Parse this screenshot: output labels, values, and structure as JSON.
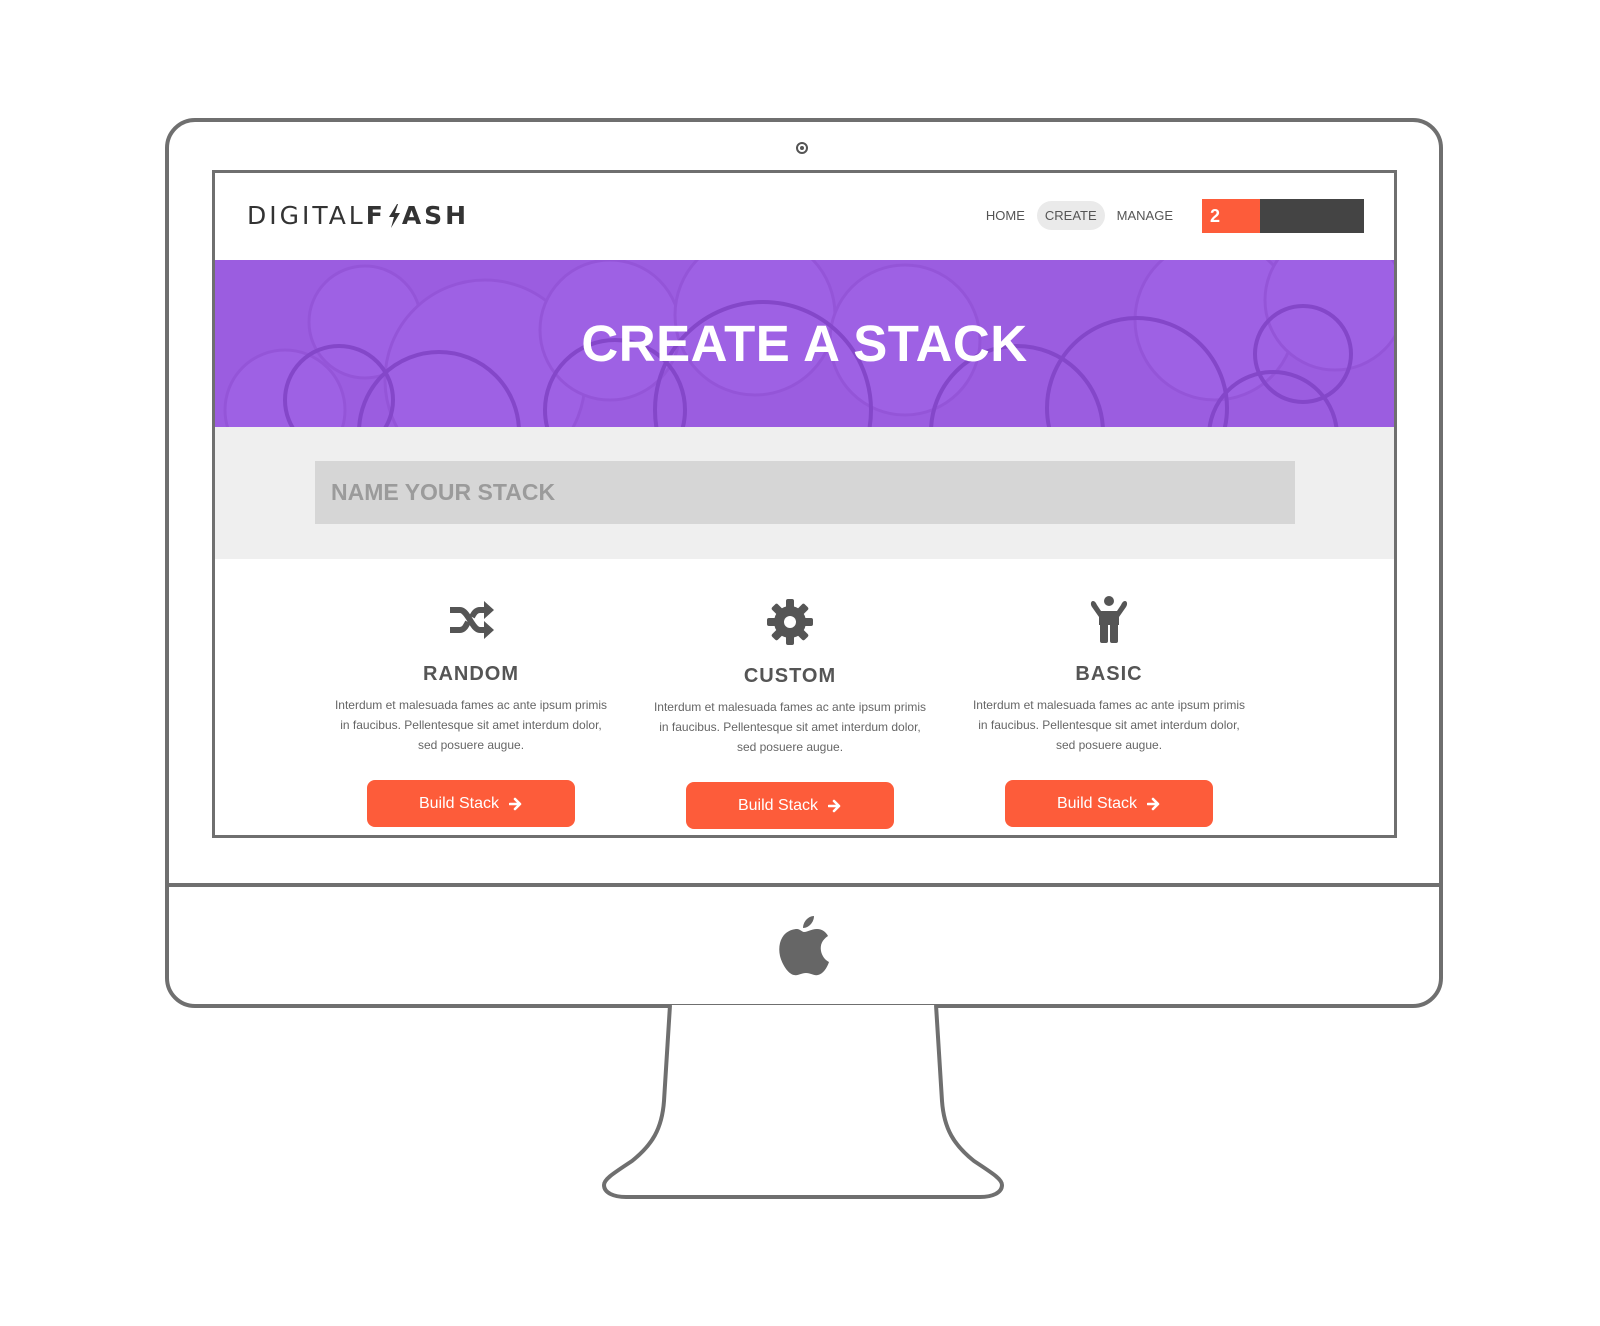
{
  "brand": {
    "logo_left": "DIGITAL",
    "logo_bolt_letter": "L",
    "logo_right": "ASH"
  },
  "nav": {
    "links": [
      {
        "label": "HOME"
      },
      {
        "label": "CREATE"
      },
      {
        "label": "MANAGE"
      }
    ],
    "cart_count": "2"
  },
  "hero": {
    "title": "CREATE A STACK"
  },
  "name_input": {
    "placeholder": "NAME YOUR STACK",
    "value": ""
  },
  "options": [
    {
      "title": "RANDOM",
      "icon": "shuffle-icon",
      "description": "Interdum et malesuada fames ac ante ipsum primis in faucibus. Pellentesque sit amet interdum dolor, sed posuere augue.",
      "button_label": "Build Stack"
    },
    {
      "title": "CUSTOM",
      "icon": "gear-icon",
      "description": "Interdum et malesuada fames ac ante ipsum primis in faucibus. Pellentesque sit amet interdum dolor, sed posuere augue.",
      "button_label": "Build Stack"
    },
    {
      "title": "BASIC",
      "icon": "child-icon",
      "description": "Interdum et malesuada fames ac ante ipsum primis in faucibus. Pellentesque sit amet interdum dolor, sed posuere augue.",
      "button_label": "Build Stack"
    }
  ],
  "colors": {
    "accent": "#fd5c3a",
    "hero": "#9b5de0",
    "dark": "#444444"
  }
}
